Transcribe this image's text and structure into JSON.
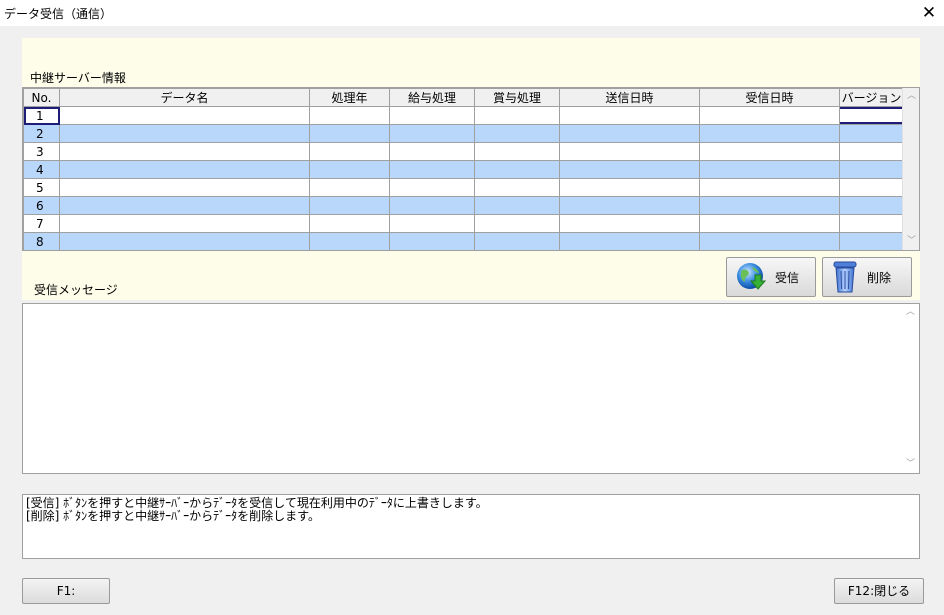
{
  "window": {
    "title": "データ受信（通信）",
    "close_glyph": "✕"
  },
  "relay_section": {
    "label": "中継サーバー情報",
    "columns": [
      "No.",
      "データ名",
      "処理年",
      "給与処理",
      "賞与処理",
      "送信日時",
      "受信日時",
      "バージョン"
    ],
    "rows": [
      {
        "no": "1",
        "selected": true
      },
      {
        "no": "2"
      },
      {
        "no": "3"
      },
      {
        "no": "4"
      },
      {
        "no": "5"
      },
      {
        "no": "6"
      },
      {
        "no": "7"
      },
      {
        "no": "8"
      }
    ],
    "row_colors": {
      "odd": "#ffffff",
      "even": "#b8d7fb"
    }
  },
  "message_section": {
    "label": "受信メッセージ",
    "value": ""
  },
  "buttons": {
    "receive": {
      "label": "受信",
      "icon": "globe-download-icon"
    },
    "delete": {
      "label": "削除",
      "icon": "trash-can-icon"
    }
  },
  "help": {
    "lines": [
      "[受信] ﾎﾞﾀﾝを押すと中継ｻｰﾊﾞｰからﾃﾞｰﾀを受信して現在利用中のﾃﾞｰﾀに上書きします。",
      "[削除] ﾎﾞﾀﾝを押すと中継ｻｰﾊﾞｰからﾃﾞｰﾀを削除します。"
    ]
  },
  "footer": {
    "f1_label": "F1:",
    "f12_label": "F12:閉じる"
  },
  "colors": {
    "panel_bg": "#fdfde9",
    "selected_row_border": "#1e1e78"
  }
}
